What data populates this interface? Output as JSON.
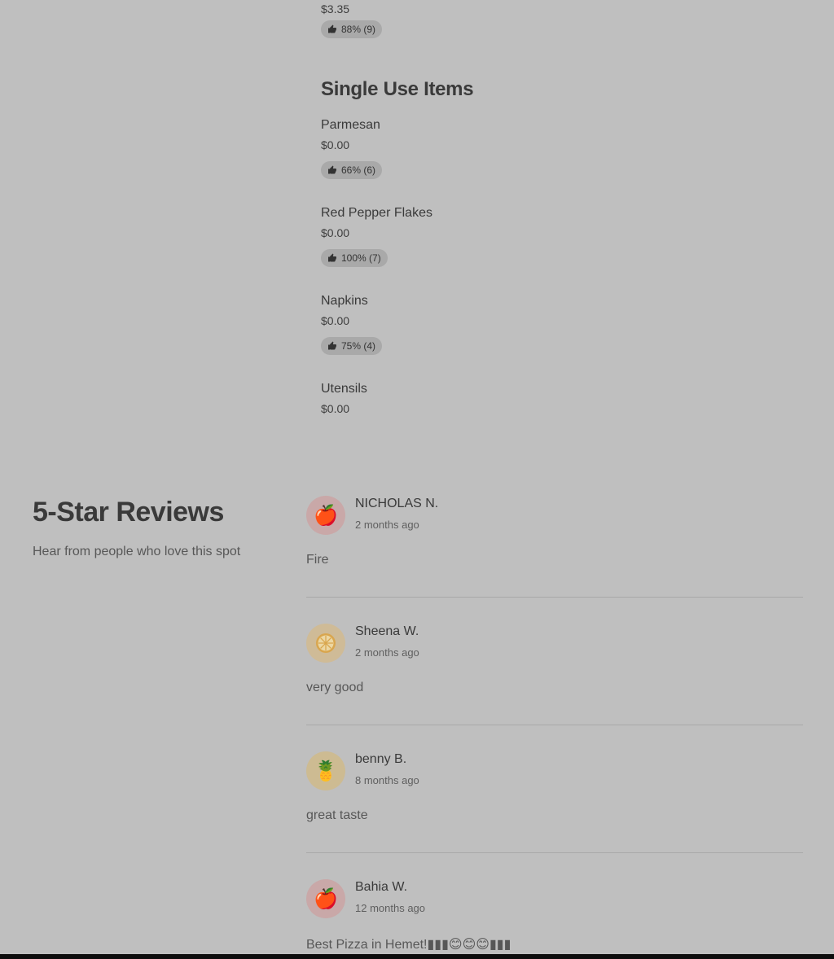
{
  "previous_item": {
    "price": "$3.35",
    "rating": "88% (9)"
  },
  "single_use": {
    "title": "Single Use Items",
    "items": [
      {
        "name": "Parmesan",
        "price": "$0.00",
        "rating": "66% (6)"
      },
      {
        "name": "Red Pepper Flakes",
        "price": "$0.00",
        "rating": "100% (7)"
      },
      {
        "name": "Napkins",
        "price": "$0.00",
        "rating": "75% (4)"
      },
      {
        "name": "Utensils",
        "price": "$0.00"
      }
    ]
  },
  "reviews": {
    "title": "5-Star Reviews",
    "subtitle": "Hear from people who love this spot",
    "items": [
      {
        "name": "NICHOLAS N.",
        "date": "2 months ago",
        "text": "Fire",
        "avatar_icon": "apple-icon",
        "avatar_color": "#c9a8a8"
      },
      {
        "name": "Sheena W.",
        "date": "2 months ago",
        "text": "very good",
        "avatar_icon": "citrus-icon",
        "avatar_color": "#cfbb97"
      },
      {
        "name": "benny B.",
        "date": "8 months ago",
        "text": "great taste",
        "avatar_icon": "pineapple-icon",
        "avatar_color": "#cdbb92"
      },
      {
        "name": "Bahia W.",
        "date": "12 months ago",
        "text": "Best Pizza in Hemet!▮▮▮😊😊😊▮▮▮",
        "avatar_icon": "apple-icon",
        "avatar_color": "#c9a8a8"
      }
    ]
  }
}
